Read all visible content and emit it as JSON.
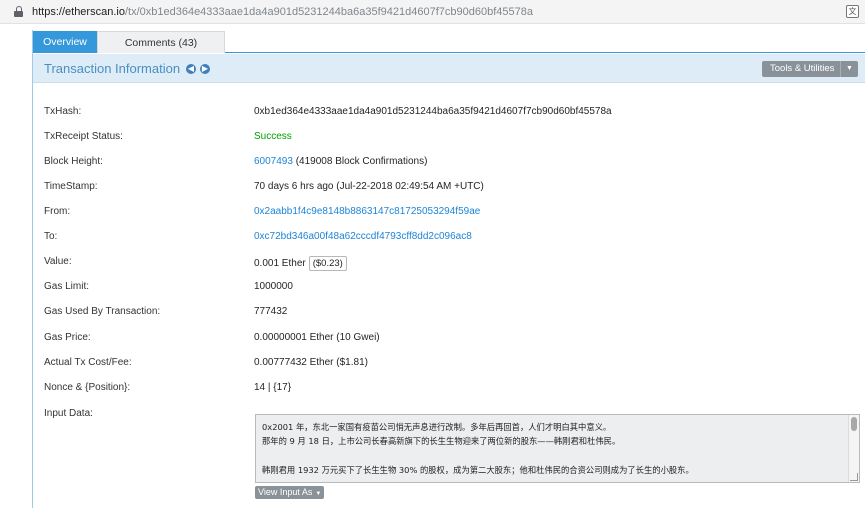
{
  "browser": {
    "url_host": "https://etherscan.io",
    "url_path": "/tx/0xb1ed364e4333aae1da4a901d5231244ba6a35f9421d4607f7cb90d60bf45578a"
  },
  "tabs": {
    "overview": "Overview",
    "comments": "Comments (43)"
  },
  "section": {
    "title": "Transaction Information",
    "prev_icon": "chevron-left-circle-icon",
    "next_icon": "chevron-right-circle-icon",
    "tools_label": "Tools & Utilities"
  },
  "fields": {
    "txhash_label": "TxHash:",
    "txhash_value": "0xb1ed364e4333aae1da4a901d5231244ba6a35f9421d4607f7cb90d60bf45578a",
    "status_label": "TxReceipt Status:",
    "status_value": "Success",
    "block_label": "Block Height:",
    "block_number": "6007493",
    "block_confirmations": " (419008 Block Confirmations)",
    "timestamp_label": "TimeStamp:",
    "timestamp_value": "70 days 6 hrs ago (Jul-22-2018 02:49:54 AM +UTC)",
    "from_label": "From:",
    "from_value": "0x2aabb1f4c9e8148b8863147c81725053294f59ae",
    "to_label": "To:",
    "to_value": "0xc72bd346a00f48a62cccdf4793cff8dd2c096ac8",
    "value_label": "Value:",
    "value_amount": "0.001 Ether",
    "value_usd": "($0.23)",
    "gas_limit_label": "Gas Limit:",
    "gas_limit_value": "1000000",
    "gas_used_label": "Gas Used By Transaction:",
    "gas_used_value": "777432",
    "gas_price_label": "Gas Price:",
    "gas_price_value": "0.00000001 Ether (10 Gwei)",
    "fee_label": "Actual Tx Cost/Fee:",
    "fee_value": "0.00777432 Ether ($1.81)",
    "nonce_label": "Nonce & {Position}:",
    "nonce_value": "14 | {17}",
    "input_label": "Input Data:"
  },
  "input_data": {
    "line1": "0x2001 年，东北一家国有疫苗公司悄无声息进行改制。多年后再回首，人们才明白其中意义。",
    "line2": "那年的 9 月 18 日，上市公司长春高新旗下的长生生物迎来了两位新的股东——韩刚君和杜伟民。",
    "line3": "",
    "line4": "韩刚君用 1932 万元买下了长生生物 30% 的股权，成为第二大股东；他和杜伟民的合资公司则成为了长生的小股东。",
    "view_button": "View Input As"
  }
}
